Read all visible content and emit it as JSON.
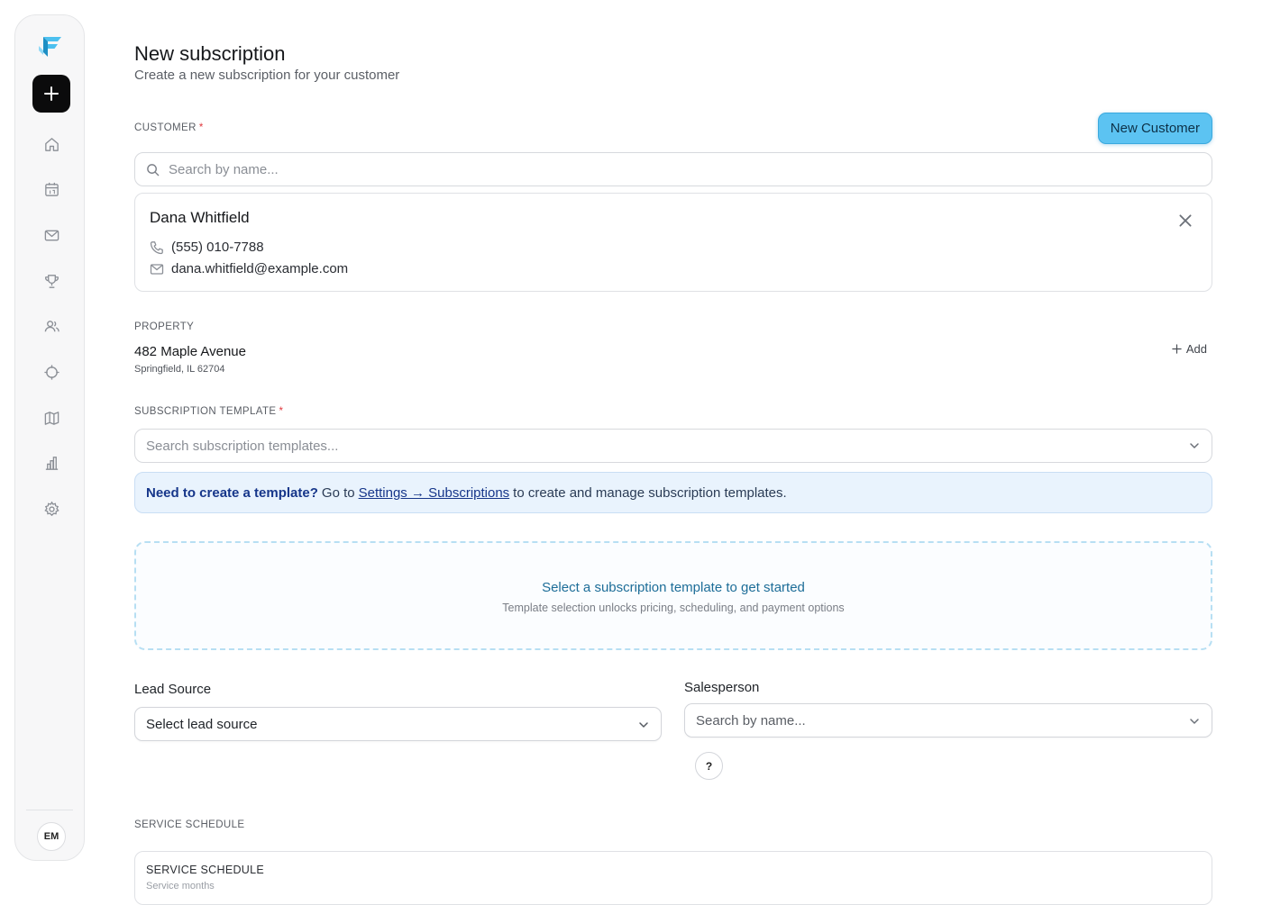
{
  "sidebar": {
    "add_label": "+",
    "avatar_initials": "EM",
    "nav": [
      "home",
      "calendar",
      "messages",
      "achievements",
      "customers",
      "routes",
      "map",
      "reports",
      "settings"
    ],
    "accent_color": "#5cc3f2"
  },
  "page": {
    "title": "New subscription",
    "subtitle": "Create a new subscription for your customer"
  },
  "customer": {
    "label": "CUSTOMER",
    "required_mark": "*",
    "new_button": "New Customer",
    "search_placeholder": "Search by name...",
    "selected": {
      "name": "Dana Whitfield",
      "phone": "(555) 010-7788",
      "email": "dana.whitfield@example.com"
    }
  },
  "property": {
    "label": "PROPERTY",
    "address": "482 Maple Avenue",
    "city": "Springfield, IL 62704",
    "add_label": "Add"
  },
  "template": {
    "label": "SUBSCRIPTION TEMPLATE",
    "required_mark": "*",
    "search_placeholder": "Search subscription templates...",
    "banner": {
      "bold": "Need to create a template?",
      "go_to": "Go to",
      "link": "Settings → Subscriptions",
      "rest": "to create and manage subscription templates."
    },
    "empty_title": "Select a subscription template to get started",
    "empty_subtitle": "Template selection unlocks pricing, scheduling, and payment options"
  },
  "lead_source": {
    "label": "Lead Source",
    "value": "Select lead source"
  },
  "salesperson": {
    "label": "Salesperson",
    "placeholder": "Search by name..."
  },
  "help": "?",
  "service_schedule": {
    "section_label": "SERVICE SCHEDULE",
    "card_title": "SERVICE SCHEDULE",
    "card_subtitle": "Service months"
  }
}
